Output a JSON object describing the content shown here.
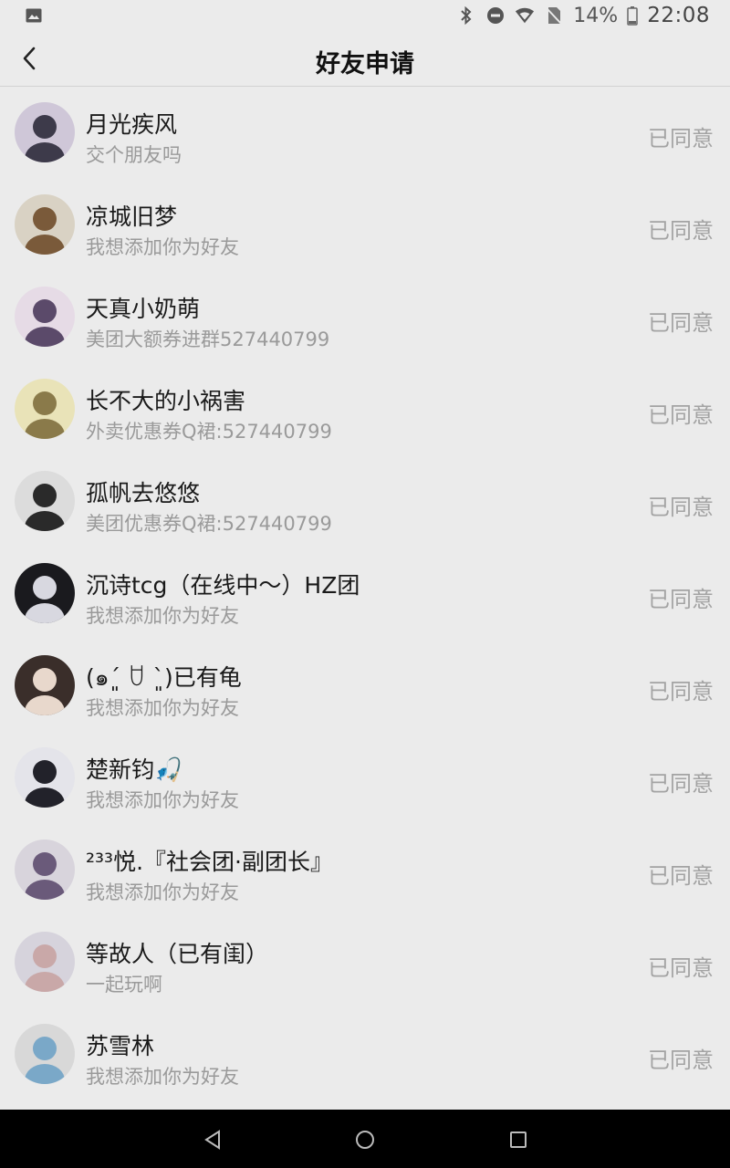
{
  "status_bar": {
    "battery_percent": "14%",
    "time": "22:08",
    "icons": [
      "image-icon",
      "bluetooth-icon",
      "do-not-disturb-icon",
      "wifi-icon",
      "no-sim-icon",
      "battery-charging-icon"
    ]
  },
  "header": {
    "title": "好友申请",
    "back_icon": "chevron-left-icon"
  },
  "requests": [
    {
      "name": "月光疾风",
      "message": "交个朋友吗",
      "status": "已同意",
      "avatar_bg": "#cfc7d8",
      "avatar_fg": "#3d3a4a"
    },
    {
      "name": "凉城旧梦",
      "message": "我想添加你为好友",
      "status": "已同意",
      "avatar_bg": "#d9d2c4",
      "avatar_fg": "#7a5a3a"
    },
    {
      "name": "天真小奶萌",
      "message": "美团大额券进群527440799",
      "status": "已同意",
      "avatar_bg": "#e6dbe6",
      "avatar_fg": "#5b4a6a"
    },
    {
      "name": "长不大的小祸害",
      "message": "外卖优惠券Q裙:527440799",
      "status": "已同意",
      "avatar_bg": "#e9e3b8",
      "avatar_fg": "#8a7a4a"
    },
    {
      "name": "孤帆去悠悠",
      "message": "美团优惠券Q裙:527440799",
      "status": "已同意",
      "avatar_bg": "#dcdcdc",
      "avatar_fg": "#2a2a2a"
    },
    {
      "name": "沉诗tcg（在线中～）HZ团",
      "message": "我想添加你为好友",
      "status": "已同意",
      "avatar_bg": "#1a1a1e",
      "avatar_fg": "#d8d8e0"
    },
    {
      "name": "(๑ˊ͈ ꇴ ˋ͈)已有龟",
      "message": "我想添加你为好友",
      "status": "已同意",
      "avatar_bg": "#3a2e2a",
      "avatar_fg": "#e8d8cc"
    },
    {
      "name": "楚新钧🎣",
      "message": "我想添加你为好友",
      "status": "已同意",
      "avatar_bg": "#e4e4ea",
      "avatar_fg": "#22222a"
    },
    {
      "name": "²³³悦.『社会团·副团长』",
      "message": "我想添加你为好友",
      "status": "已同意",
      "avatar_bg": "#d8d4dc",
      "avatar_fg": "#6a5a7a"
    },
    {
      "name": "等故人（已有闺）",
      "message": "一起玩啊",
      "status": "已同意",
      "avatar_bg": "#d6d3dc",
      "avatar_fg": "#c9a8a8"
    },
    {
      "name": "苏雪林",
      "message": "我想添加你为好友",
      "status": "已同意",
      "avatar_bg": "#d8d8d8",
      "avatar_fg": "#7aa8c8"
    }
  ],
  "nav_bar": {
    "icons": [
      "back-triangle-icon",
      "home-circle-icon",
      "recents-square-icon"
    ]
  }
}
